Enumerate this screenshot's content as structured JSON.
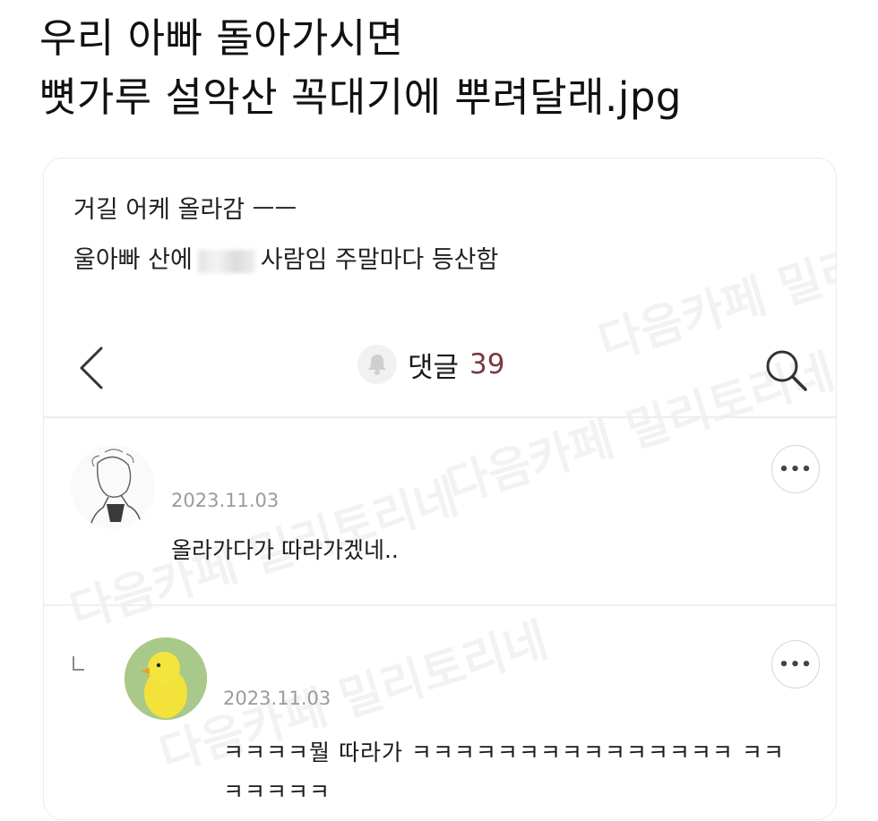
{
  "headline": {
    "line1": "우리 아빠 돌아가시면",
    "line2": "뼛가루 설악산 꼭대기에 뿌려달래.jpg"
  },
  "post": {
    "line1": "거길 어케 올라감 ㅡㅡ",
    "line2_before": "울아빠 산에",
    "line2_after": "사람임 주말마다 등산함"
  },
  "nav": {
    "comments_label": "댓글",
    "comments_count": "39",
    "back_icon": "chevron-left-icon",
    "bell_icon": "bell-icon",
    "search_icon": "search-icon"
  },
  "comments": [
    {
      "date": "2023.11.03",
      "text": "올라가다가 따라가겠네..",
      "avatar": "sketch-person-avatar"
    },
    {
      "is_reply": true,
      "date": "2023.11.03",
      "text": "ㅋㅋㅋㅋ뭘 따라가 ㅋㅋㅋㅋㅋㅋㅋㅋㅋㅋㅋㅋㅋㅋㅋ ㅋㅋㅋㅋㅋㅋㅋ",
      "avatar": "yellow-bird-avatar"
    }
  ],
  "more_label": "•••",
  "watermark": "다음카페 밀리토리네",
  "colors": {
    "count": "#7a3a40",
    "date": "#9b9b9b",
    "divider": "#eeeeee"
  }
}
